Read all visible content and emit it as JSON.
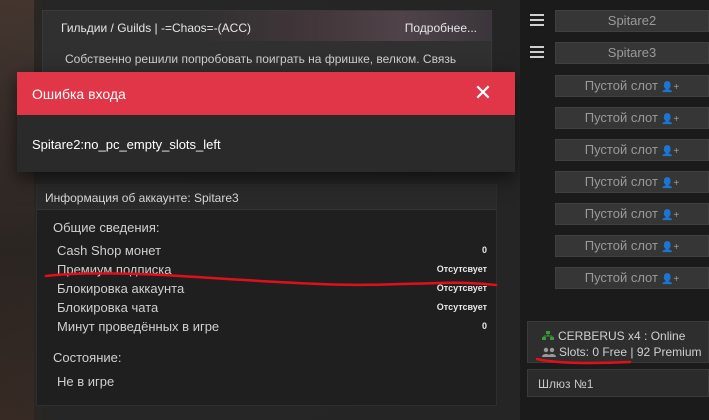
{
  "news": {
    "title": "Гильдии / Guilds | -=Chaos=-(ACC)",
    "more": "Подробнее...",
    "text": "Собственно решили попробовать поиграть на фришке, велком. Связь"
  },
  "dialog": {
    "title": "Ошибка входа",
    "message": "Spitare2:no_pc_empty_slots_left",
    "close_icon": "close-icon",
    "header_color": "#e13648"
  },
  "account": {
    "title": "Информация об аккаунте: Spitare3",
    "general_label": "Общие сведения:",
    "rows": [
      {
        "label": "Cash Shop монет",
        "value": "0"
      },
      {
        "label": "Премиум подписка",
        "value": "Отсутсвует"
      },
      {
        "label": "Блокировка аккаунта",
        "value": "Отсутсвует"
      },
      {
        "label": "Блокировка чата",
        "value": "Отсутсвует"
      },
      {
        "label": "Минут проведённых в игре",
        "value": "0"
      }
    ],
    "state_label": "Состояние:",
    "state_value": "Не в игре"
  },
  "sidebar": {
    "characters": [
      "Spitare2",
      "Spitare3"
    ],
    "empty_slot_label": "Пустой слот",
    "empty_slot_count": 7,
    "server": {
      "line1": "CERBERUS x4 : Online",
      "line2": "Slots: 0 Free | 92 Premium"
    },
    "gateway": "Шлюз №1"
  },
  "annotation_color": "#e0101a"
}
